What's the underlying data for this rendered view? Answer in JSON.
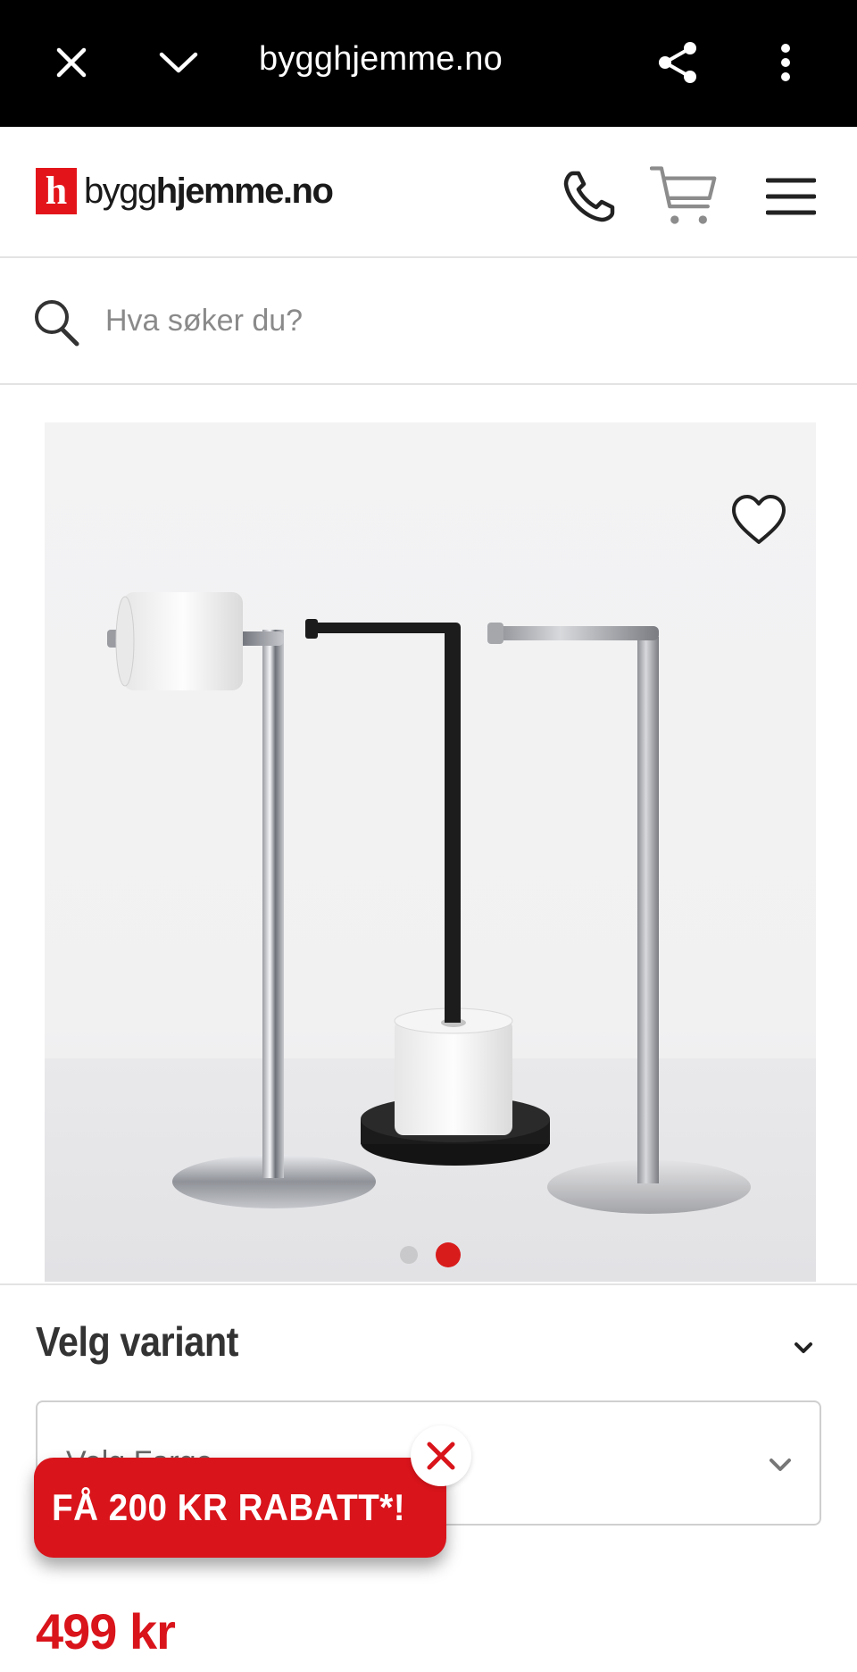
{
  "browser": {
    "url": "bygghjemme.no",
    "icons": [
      "close-icon",
      "chevron-down-icon",
      "share-icon",
      "more-vertical-icon"
    ]
  },
  "header": {
    "logo_mark": "h",
    "logo_text_light": "bygg",
    "logo_text_bold": "hjemme",
    "logo_text_suffix": ".no",
    "icons": [
      "phone-icon",
      "cart-icon",
      "menu-icon"
    ],
    "brand_color": "#e3151b"
  },
  "search": {
    "placeholder": "Hva søker du?",
    "value": ""
  },
  "gallery": {
    "image_count": 2,
    "active_index": 2,
    "favorite_icon": "heart-outline-icon"
  },
  "variant": {
    "title": "Velg variant",
    "select_text": "Velg Farge"
  },
  "promo": {
    "label": "FÅ 200 KR RABATT*!",
    "color": "#d9141b"
  },
  "price": {
    "value": "499 kr",
    "color": "#d9141b"
  }
}
